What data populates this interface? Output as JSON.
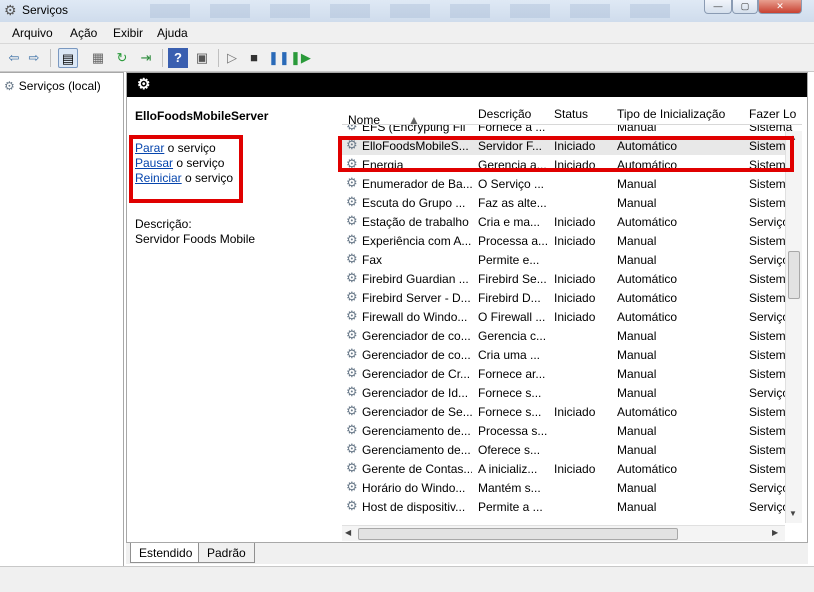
{
  "window": {
    "title": "Serviços"
  },
  "menu": [
    "Arquivo",
    "Ação",
    "Exibir",
    "Ajuda"
  ],
  "tree": {
    "root_label": "Serviços (local)"
  },
  "selected_service": {
    "name": "ElloFoodsMobileServer",
    "actions": [
      {
        "link": "Parar",
        "rest": " o serviço"
      },
      {
        "link": "Pausar",
        "rest": " o serviço"
      },
      {
        "link": "Reiniciar",
        "rest": " o serviço"
      }
    ],
    "description_label": "Descrição:",
    "description": "Servidor Foods Mobile"
  },
  "table": {
    "headers": [
      "Nome",
      "Descrição",
      "Status",
      "Tipo de Inicialização",
      "Fazer Lo"
    ],
    "rows": [
      {
        "name": "EFS (Encrypting Fil",
        "desc": "Fornece a ...",
        "status": "",
        "start": "Manual",
        "logon": "Sistema"
      },
      {
        "name": "ElloFoodsMobileS...",
        "desc": "Servidor F...",
        "status": "Iniciado",
        "start": "Automático",
        "logon": "Sistema"
      },
      {
        "name": "Energia",
        "desc": "Gerencia a...",
        "status": "Iniciado",
        "start": "Automático",
        "logon": "Sistema"
      },
      {
        "name": "Enumerador de Ba...",
        "desc": "O Serviço ...",
        "status": "",
        "start": "Manual",
        "logon": "Sistema"
      },
      {
        "name": "Escuta do Grupo ...",
        "desc": "Faz as alte...",
        "status": "",
        "start": "Manual",
        "logon": "Sistema"
      },
      {
        "name": "Estação de trabalho",
        "desc": "Cria e ma...",
        "status": "Iniciado",
        "start": "Automático",
        "logon": "Serviço"
      },
      {
        "name": "Experiência com A...",
        "desc": "Processa a...",
        "status": "Iniciado",
        "start": "Manual",
        "logon": "Sistema"
      },
      {
        "name": "Fax",
        "desc": "Permite e...",
        "status": "",
        "start": "Manual",
        "logon": "Serviço"
      },
      {
        "name": "Firebird Guardian ...",
        "desc": "Firebird Se...",
        "status": "Iniciado",
        "start": "Automático",
        "logon": "Sistema"
      },
      {
        "name": "Firebird Server - D...",
        "desc": "Firebird D...",
        "status": "Iniciado",
        "start": "Automático",
        "logon": "Sistema"
      },
      {
        "name": "Firewall do Windo...",
        "desc": "O Firewall ...",
        "status": "Iniciado",
        "start": "Automático",
        "logon": "Serviço"
      },
      {
        "name": "Gerenciador de co...",
        "desc": "Gerencia c...",
        "status": "",
        "start": "Manual",
        "logon": "Sistema"
      },
      {
        "name": "Gerenciador de co...",
        "desc": "Cria uma ...",
        "status": "",
        "start": "Manual",
        "logon": "Sistema"
      },
      {
        "name": "Gerenciador de Cr...",
        "desc": "Fornece ar...",
        "status": "",
        "start": "Manual",
        "logon": "Sistema"
      },
      {
        "name": "Gerenciador de Id...",
        "desc": "Fornece s...",
        "status": "",
        "start": "Manual",
        "logon": "Serviço"
      },
      {
        "name": "Gerenciador de Se...",
        "desc": "Fornece s...",
        "status": "Iniciado",
        "start": "Automático",
        "logon": "Sistema"
      },
      {
        "name": "Gerenciamento de...",
        "desc": "Processa s...",
        "status": "",
        "start": "Manual",
        "logon": "Sistema"
      },
      {
        "name": "Gerenciamento de...",
        "desc": "Oferece s...",
        "status": "",
        "start": "Manual",
        "logon": "Sistema"
      },
      {
        "name": "Gerente de Contas...",
        "desc": "A inicializ...",
        "status": "Iniciado",
        "start": "Automático",
        "logon": "Sistema"
      },
      {
        "name": "Horário do Windo...",
        "desc": "Mantém s...",
        "status": "",
        "start": "Manual",
        "logon": "Serviço"
      },
      {
        "name": "Host de dispositiv...",
        "desc": "Permite a ...",
        "status": "",
        "start": "Manual",
        "logon": "Serviço"
      }
    ]
  },
  "tabs": [
    "Estendido",
    "Padrão"
  ],
  "colors": {
    "highlight": "#e00000",
    "link": "#0645ad",
    "selected_row": "#e8e8e8"
  },
  "icons": [
    "gear-icon",
    "back-arrow-icon",
    "forward-arrow-icon",
    "play-icon",
    "stop-icon",
    "pause-icon",
    "restart-icon",
    "help-icon"
  ]
}
